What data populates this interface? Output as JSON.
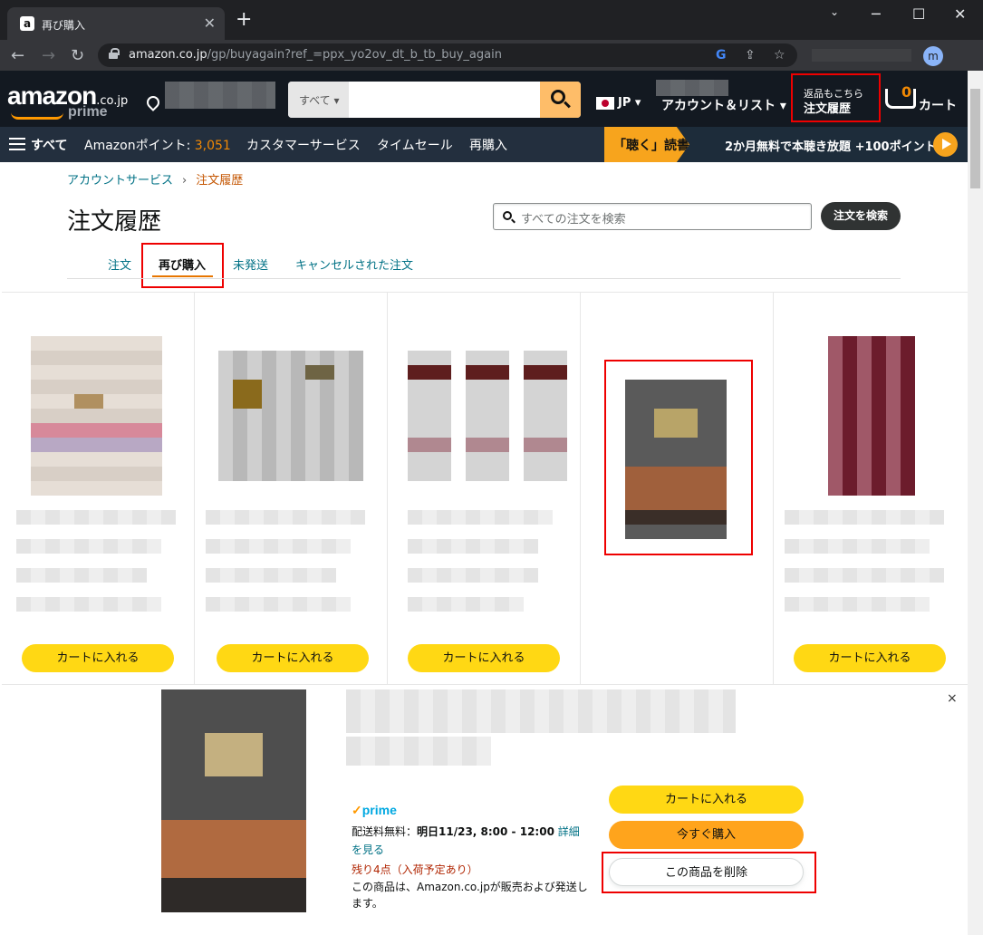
{
  "browser": {
    "tab_title": "再び購入",
    "url_host": "amazon.co.jp",
    "url_path": "/gp/buyagain?ref_=ppx_yo2ov_dt_b_tb_buy_again",
    "profile_initial": "m",
    "new_tab": "+",
    "tab_close": "✕",
    "min": "─",
    "max": "☐",
    "close": "✕",
    "back": "←",
    "forward": "→",
    "reload": "↻",
    "google": "G",
    "share": "⇪",
    "star": "☆"
  },
  "header": {
    "logo": "amazon",
    "logo_tld": ".co.jp",
    "logo_prime": "prime",
    "search_category": "すべて",
    "language": "JP",
    "account_label": "アカウント＆リスト",
    "orders_line1": "返品もこちら",
    "orders_line2": "注文履歴",
    "cart_count": "0",
    "cart_label": "カート"
  },
  "subnav": {
    "all": "すべて",
    "points_label": "Amazonポイント: ",
    "points_value": "3,051",
    "customer_service": "カスタマーサービス",
    "timesale": "タイムセール",
    "buy_again": "再購入",
    "promo_tag": "「聴く」読書",
    "promo_text": "2か月無料で本聴き放題 +100ポイント"
  },
  "page": {
    "breadcrumb_1": "アカウントサービス",
    "breadcrumb_sep": "›",
    "breadcrumb_2": "注文履歴",
    "title": "注文履歴",
    "search_placeholder": "すべての注文を検索",
    "search_button": "注文を検索",
    "tabs": [
      "注文",
      "再び購入",
      "未発送",
      "キャンセルされた注文"
    ]
  },
  "grid": {
    "add_to_cart": "カートに入れる"
  },
  "detail": {
    "prime": "prime",
    "prime_check": "✓",
    "shipping_text": "配送料無料：",
    "shipping_date": "明日11/23, 8:00 - 12:00",
    "details_link": "詳細を見る",
    "stock": "残り4点（入荷予定あり）",
    "seller": "この商品は、Amazon.co.jpが販売および発送します。",
    "add_to_cart": "カートに入れる",
    "buy_now": "今すぐ購入",
    "remove": "この商品を削除",
    "close": "×"
  }
}
